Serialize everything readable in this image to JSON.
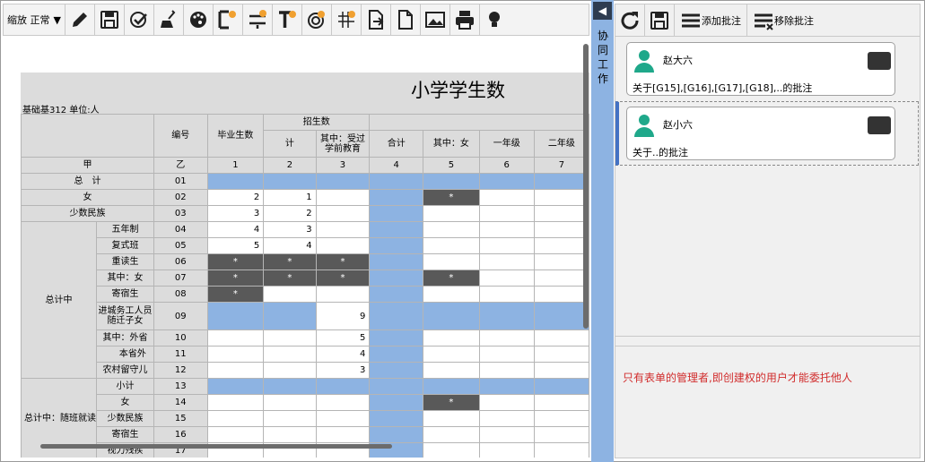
{
  "toolbar": {
    "zoom_label": "缩放",
    "zoom_value": "正常"
  },
  "report": {
    "title": "小学学生数",
    "unit": "基础基312 单位:人",
    "header": {
      "code": "编号",
      "graduates": "毕业生数",
      "enroll": "招生数",
      "enroll_total": "计",
      "enroll_preschool": "其中：受过学前教育",
      "total": "合计",
      "female": "其中：女",
      "grade1": "一年级",
      "grade2": "二年级"
    },
    "colnum": [
      "甲",
      "乙",
      "1",
      "2",
      "3",
      "4",
      "5",
      "6",
      "7"
    ],
    "group1": "总计中",
    "group2": "总计中：随班就读",
    "rows": [
      {
        "label": "总　计",
        "code": "01",
        "v1": "",
        "v2": "",
        "v3": ""
      },
      {
        "label": "女",
        "code": "02",
        "v1": "2",
        "v2": "1",
        "v3": ""
      },
      {
        "label": "少数民族",
        "code": "03",
        "v1": "3",
        "v2": "2",
        "v3": ""
      },
      {
        "label": "五年制",
        "code": "04",
        "v1": "4",
        "v2": "3",
        "v3": ""
      },
      {
        "label": "复式班",
        "code": "05",
        "v1": "5",
        "v2": "4",
        "v3": ""
      },
      {
        "label": "重读生",
        "code": "06",
        "v1": "*",
        "v2": "*",
        "v3": "*"
      },
      {
        "label": "其中：女",
        "code": "07",
        "v1": "*",
        "v2": "*",
        "v3": "*"
      },
      {
        "label": "寄宿生",
        "code": "08",
        "v1": "*",
        "v2": "",
        "v3": ""
      },
      {
        "label": "进城务工人员随迁子女",
        "code": "09",
        "v1": "",
        "v2": "",
        "v3": "9"
      },
      {
        "label": "其中：外省",
        "code": "10",
        "v1": "",
        "v2": "",
        "v3": "5"
      },
      {
        "label": "本省外",
        "code": "11",
        "v1": "",
        "v2": "",
        "v3": "4"
      },
      {
        "label": "农村留守儿",
        "code": "12",
        "v1": "",
        "v2": "",
        "v3": "3"
      },
      {
        "label": "小计",
        "code": "13",
        "v1": "",
        "v2": "",
        "v3": ""
      },
      {
        "label": "女",
        "code": "14",
        "v1": "",
        "v2": "",
        "v3": ""
      },
      {
        "label": "少数民族",
        "code": "15",
        "v1": "",
        "v2": "",
        "v3": ""
      },
      {
        "label": "寄宿生",
        "code": "16",
        "v1": "",
        "v2": "",
        "v3": ""
      },
      {
        "label": "视力残疾",
        "code": "17",
        "v1": "",
        "v2": "",
        "v3": ""
      }
    ],
    "star": "*"
  },
  "side": {
    "label": "协同工作"
  },
  "panel": {
    "add_label": "添加批注",
    "remove_label": "移除批注",
    "cards": [
      {
        "name": "赵大六",
        "text": "关于[G15],[G16],[G17],[G18],..的批注"
      },
      {
        "name": "赵小六",
        "text": "关于..的批注"
      }
    ],
    "warning": "只有表单的管理者,即创建权的用户才能委托他人"
  },
  "colors": {
    "blue": "#8db3e2",
    "dark": "#595959",
    "warning": "#d12b2b"
  }
}
